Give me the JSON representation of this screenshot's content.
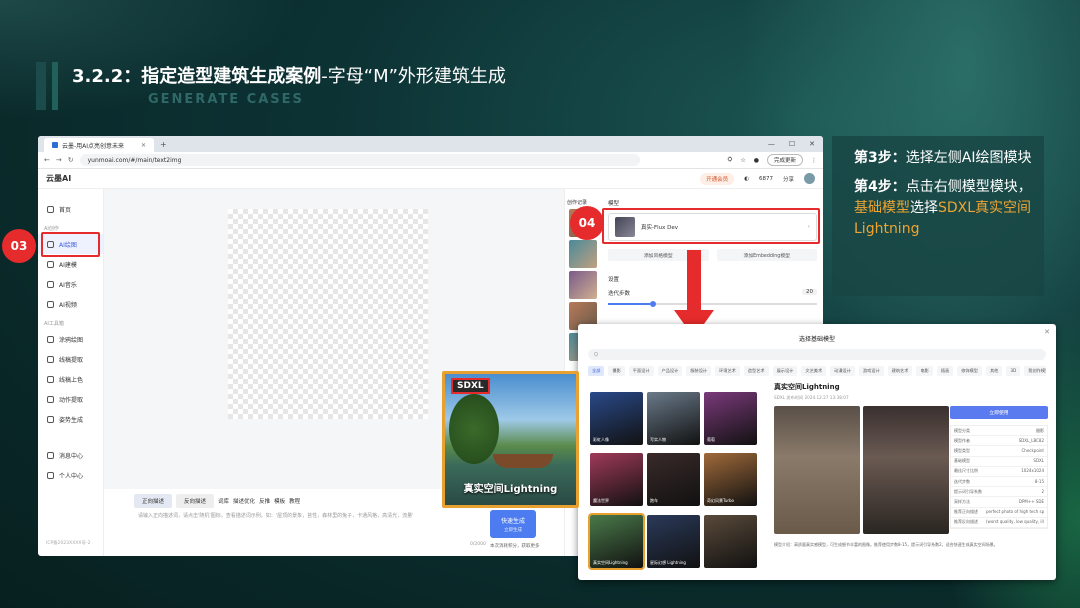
{
  "slide": {
    "title_main": "3.2.2：指定造型建筑生成案例",
    "title_sub": "-字母“M”外形建筑生成",
    "subtitle": "GENERATE CASES"
  },
  "browser": {
    "tab_title": "云墨-用AI点亮创意未来",
    "url": "yunmoai.com/#/main/text2img",
    "update_button": "完成更新"
  },
  "app": {
    "logo": "云墨AI",
    "vip_button": "开通会员",
    "points": "6877",
    "share": "分享",
    "sidebar": {
      "home": "首页",
      "section_ai": "AI创作",
      "items": [
        "AI绘图",
        "AI建模",
        "AI音乐",
        "AI视频"
      ],
      "section_tools": "AI工具箱",
      "tools": [
        "涂鸦绘图",
        "线稿提取",
        "线稿上色",
        "动作提取",
        "姿势生成"
      ],
      "bottom": [
        "消息中心",
        "个人中心"
      ],
      "footer": "ICP备2023XXXX号-2"
    },
    "prompt": {
      "tab_positive": "正向描述",
      "tab_negative": "反向描述",
      "tools": [
        "词库",
        "描述优化",
        "反推",
        "模板",
        "教程"
      ],
      "placeholder": "请输入正向描述词，请点击'随机'图标，查看描述词示例。如：'屋顶的景象，苔性，森林里的兔子，卡通风格，高清光，流量'",
      "count": "0/2000",
      "generate": "快速生成",
      "generate_sub": "立即生成",
      "note": "本次消耗积分，获取更多"
    },
    "history_label": "创作记录",
    "right_panel": {
      "model_label": "模型",
      "model_name": "真实-Flux Dev",
      "add_lora": "添加风格模型",
      "add_embedding": "添加Embedding模型",
      "settings_label": "设置",
      "steps_label": "迭代步数",
      "steps_value": "20"
    }
  },
  "steps": {
    "step3_label": "第3步：",
    "step3_text": "选择左侧AI绘图模块",
    "step4_label": "第4步：",
    "step4_text_a": "点击右侧模型模块，",
    "step4_hl": "基础模型",
    "step4_text_b": "选择",
    "step4_hl2": "SDXL真实空间Lightning",
    "badge3": "03",
    "badge4": "04"
  },
  "modal": {
    "title": "选择基础模型",
    "search_placeholder": "Q",
    "categories": [
      "全部",
      "摄影",
      "平面设计",
      "产品设计",
      "服装设计",
      "环境艺术",
      "造型艺术",
      "展示设计",
      "文艺美术",
      "动漫设计",
      "游戏设计",
      "建筑艺术",
      "电影",
      "插画",
      "修饰模型",
      "其他",
      "3D",
      "我创作模型与保存模型"
    ],
    "cells": [
      {
        "label": "彩虹人像",
        "color": "#2a4a8a"
      },
      {
        "label": "写实人物",
        "color": "#6a7a8a"
      },
      {
        "label": "葡萄",
        "color": "#7a3a7a"
      },
      {
        "label": "魔法世界",
        "color": "#a03a5a"
      },
      {
        "label": "跑车",
        "color": "#3a2a2a"
      },
      {
        "label": "奇幻风景Turbo",
        "color": "#a06a3a"
      },
      {
        "label": "真实空间Lightning",
        "color": "#4a7a4a"
      },
      {
        "label": "星际幻想 Lightning",
        "color": "#2a3a5a"
      },
      {
        "label": "",
        "color": "#5a4a3a"
      }
    ],
    "detail_title": "真实空间Lightning",
    "detail_meta": "SDXL  发布时间 2024.12.27 13:38:07",
    "download_button": "立即使用",
    "spec": [
      [
        "模型分类",
        "摄影"
      ],
      [
        "模型作者",
        "SDXL_LBC82"
      ],
      [
        "模型类型",
        "Checkpoint"
      ],
      [
        "基础模型",
        "SDXL"
      ],
      [
        "最佳尺寸比例",
        "1024x1024"
      ],
      [
        "迭代步数",
        "8-15"
      ],
      [
        "提示词引导系数",
        "2"
      ],
      [
        "采样方法",
        "DPM++ SDE"
      ],
      [
        "推荐正向描述",
        "perfect photo of high tech spa..."
      ],
      [
        "推荐反向描述",
        "(worst quality, low quality, illus..."
      ]
    ],
    "detail_desc": "模型介绍：高质量真实感模型，可生成细节丰富的图像。推荐使用步数8-15，提示词引导系数2，适合快速生成真实空间场景。"
  },
  "zoom": {
    "tag": "SDXL",
    "label": "真实空间Lightning"
  },
  "colors": {
    "accent_red": "#e52b2b",
    "highlight_orange": "#f0a431",
    "brand_blue": "#4d7cf0",
    "slide_bg": "#0d3335"
  }
}
